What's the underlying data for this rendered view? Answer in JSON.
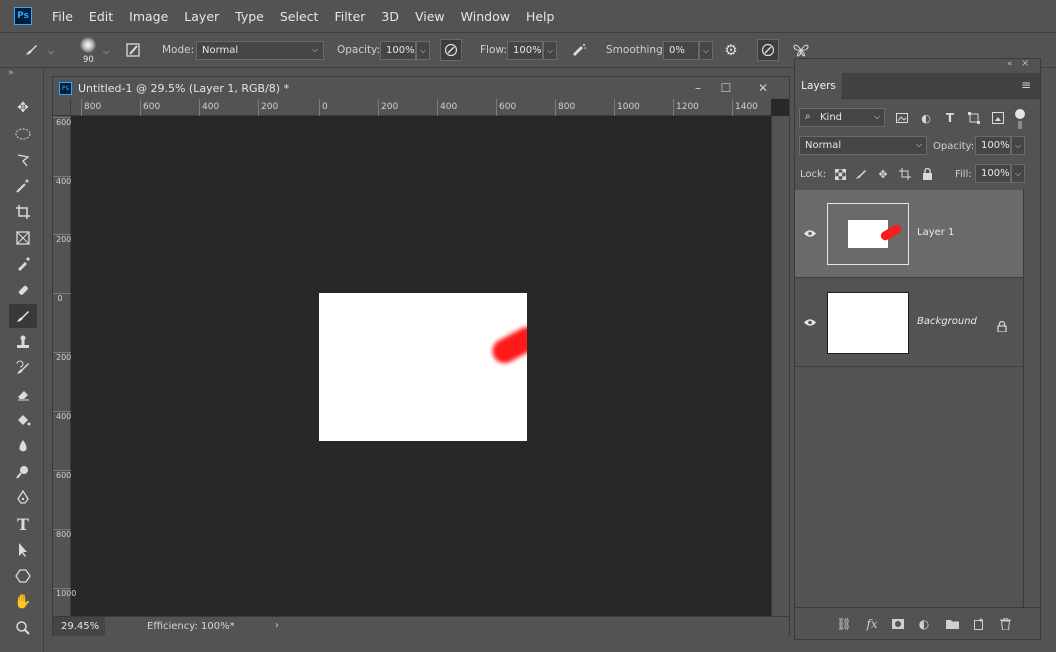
{
  "app": {
    "logo": "Ps"
  },
  "menu": [
    "File",
    "Edit",
    "Image",
    "Layer",
    "Type",
    "Select",
    "Filter",
    "3D",
    "View",
    "Window",
    "Help"
  ],
  "options": {
    "brush_size": "90",
    "mode_label": "Mode:",
    "mode_value": "Normal",
    "opacity_label": "Opacity:",
    "opacity_value": "100%",
    "flow_label": "Flow:",
    "flow_value": "100%",
    "smoothing_label": "Smoothing:",
    "smoothing_value": "0%"
  },
  "document": {
    "title": "Untitled-1 @ 29.5% (Layer 1, RGB/8) *",
    "ruler_h": [
      "800",
      "600",
      "400",
      "200",
      "0",
      "200",
      "400",
      "600",
      "800",
      "1000",
      "1200",
      "1400"
    ],
    "ruler_v": [
      "600",
      "400",
      "200",
      "0",
      "200",
      "400",
      "600",
      "800",
      "1000"
    ],
    "zoom": "29.45%",
    "efficiency": "Efficiency: 100%*"
  },
  "layers_panel": {
    "tab": "Layers",
    "filter_kind": "Kind",
    "blend_mode": "Normal",
    "opacity_label": "Opacity:",
    "opacity_value": "100%",
    "lock_label": "Lock:",
    "fill_label": "Fill:",
    "fill_value": "100%",
    "layers": [
      {
        "name": "Layer 1",
        "selected": true
      },
      {
        "name": "Background",
        "selected": false
      }
    ]
  },
  "colors": {
    "accent": "#31a8ff",
    "stroke": "#ff1a1a"
  }
}
